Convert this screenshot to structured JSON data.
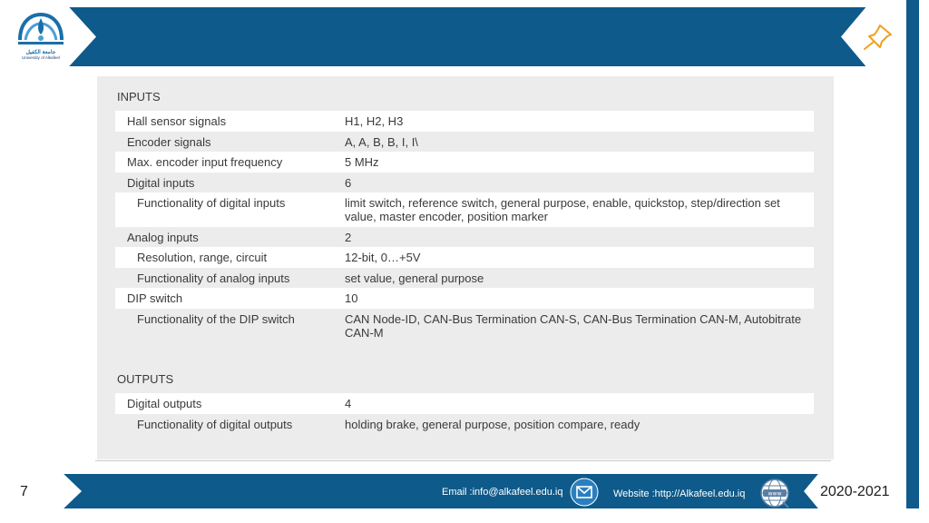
{
  "header": {
    "logo_text_ar": "جامعة الكفيل",
    "logo_text_en": "University of Alkafeel"
  },
  "inputs": {
    "heading": "INPUTS",
    "rows": [
      {
        "label": "Hall sensor signals",
        "value": "H1, H2, H3"
      },
      {
        "label": "Encoder signals",
        "value": "A, A, B, B, I, I\\"
      },
      {
        "label": "Max. encoder input frequency",
        "value": "5 MHz"
      },
      {
        "label": "Digital inputs",
        "value": "6"
      },
      {
        "label": "Functionality of digital inputs",
        "value": "limit switch, reference switch, general purpose, enable, quickstop, step/direction set value, master encoder, position marker"
      },
      {
        "label": "Analog inputs",
        "value": "2"
      },
      {
        "label": "Resolution, range, circuit",
        "value": "12-bit, 0…+5V"
      },
      {
        "label": "Functionality of analog inputs",
        "value": "set value, general purpose"
      },
      {
        "label": "DIP switch",
        "value": "10"
      },
      {
        "label": "Functionality of the DIP switch",
        "value": "CAN Node-ID, CAN-Bus Termination CAN-S, CAN-Bus Termination CAN-M, Autobitrate CAN-M"
      }
    ]
  },
  "outputs": {
    "heading": "OUTPUTS",
    "rows": [
      {
        "label": "Digital outputs",
        "value": "4"
      },
      {
        "label": "Functionality of digital outputs",
        "value": "holding brake, general purpose, position compare, ready"
      }
    ]
  },
  "footer": {
    "page_number": "7",
    "email": "Email :info@alkafeel.edu.iq",
    "website": "Website :http://Alkafeel.edu.iq",
    "year": "2020-2021"
  },
  "icons": {
    "logo": "university-logo",
    "pin": "pushpin-icon",
    "mail": "envelope-icon",
    "web": "globe-www-icon"
  },
  "colors": {
    "primary": "#0e5a8a",
    "panel": "#ececec",
    "pin": "#f0a020"
  }
}
